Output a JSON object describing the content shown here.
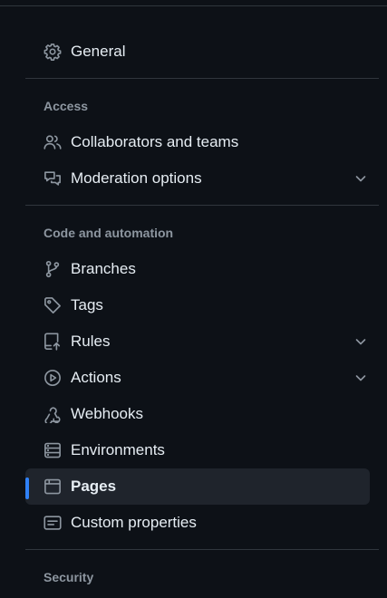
{
  "sections": {
    "general": {
      "label": "General",
      "icon": "gear-icon"
    },
    "access": {
      "title": "Access",
      "items": [
        {
          "label": "Collaborators and teams",
          "icon": "people-icon"
        },
        {
          "label": "Moderation options",
          "icon": "comment-discussion-icon",
          "expandable": true
        }
      ]
    },
    "code_automation": {
      "title": "Code and automation",
      "items": [
        {
          "label": "Branches",
          "icon": "git-branch-icon"
        },
        {
          "label": "Tags",
          "icon": "tag-icon"
        },
        {
          "label": "Rules",
          "icon": "repo-push-icon",
          "expandable": true
        },
        {
          "label": "Actions",
          "icon": "play-icon",
          "expandable": true
        },
        {
          "label": "Webhooks",
          "icon": "webhook-icon"
        },
        {
          "label": "Environments",
          "icon": "server-icon"
        },
        {
          "label": "Pages",
          "icon": "browser-icon",
          "selected": true
        },
        {
          "label": "Custom properties",
          "icon": "note-icon"
        }
      ]
    },
    "security": {
      "title": "Security"
    }
  },
  "colors": {
    "background": "#0d1117",
    "text": "#e6edf3",
    "muted": "#8d96a0",
    "border": "#30363d",
    "selected_bg": "#1f242c",
    "accent": "#2f81f7"
  }
}
